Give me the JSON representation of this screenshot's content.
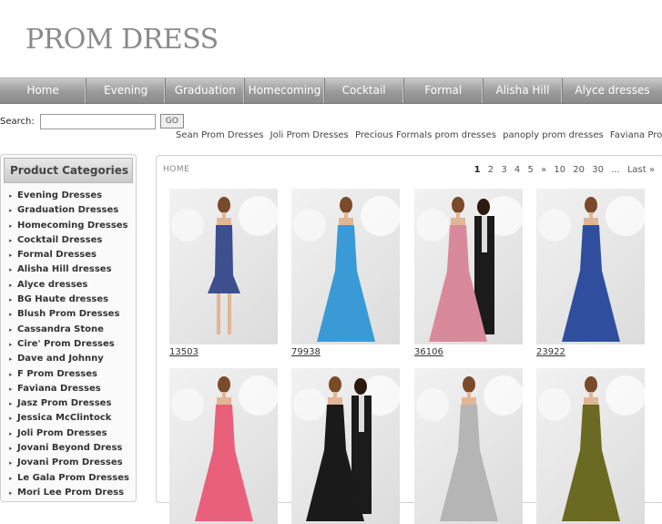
{
  "logo": "PROM DRESS",
  "nav": [
    "Home",
    "Evening",
    "Graduation",
    "Homecoming",
    "Cocktail",
    "Formal",
    "Alisha Hill",
    "Alyce dresses"
  ],
  "search": {
    "label": "Search:",
    "placeholder": "",
    "button": "GO"
  },
  "brand_links": [
    "Sean Prom Dresses",
    "Joli Prom Dresses",
    "Precious Formals prom dresses",
    "panoply prom dresses",
    "Faviana Prom"
  ],
  "sidebar": {
    "title": "Product Categories",
    "items": [
      "Evening Dresses",
      "Graduation Dresses",
      "Homecoming Dresses",
      "Cocktail Dresses",
      "Formal Dresses",
      "Alisha Hill dresses",
      "Alyce dresses",
      "BG Haute dresses",
      "Blush Prom Dresses",
      "Cassandra Stone",
      "Cire' Prom Dresses",
      "Dave and Johnny",
      "F Prom Dresses",
      "Faviana Dresses",
      "Jasz Prom Dresses",
      "Jessica McClintock",
      "Joli Prom Dresses",
      "Jovani Beyond Dress",
      "Jovani Prom Dresses",
      "Le Gala Prom Dresses",
      "Mori Lee Prom Dress"
    ]
  },
  "breadcrumb": "HOME",
  "pager": {
    "current": "1",
    "pages": [
      "2",
      "3",
      "4",
      "5",
      "»",
      "10",
      "20",
      "30",
      "...",
      "Last »"
    ]
  },
  "products": [
    {
      "code": "13503",
      "color": "#3d4f8f",
      "style": "short"
    },
    {
      "code": "79938",
      "color": "#3a9ad6",
      "style": "long"
    },
    {
      "code": "36106",
      "color": "#d98a9a",
      "style": "couple"
    },
    {
      "code": "23922",
      "color": "#2f4f9e",
      "style": "long"
    },
    {
      "code": "",
      "color": "#e8607a",
      "style": "long"
    },
    {
      "code": "",
      "color": "#1a1a1a",
      "style": "couple"
    },
    {
      "code": "",
      "color": "#b5b5b5",
      "style": "long"
    },
    {
      "code": "",
      "color": "#6b6a22",
      "style": "long"
    }
  ]
}
